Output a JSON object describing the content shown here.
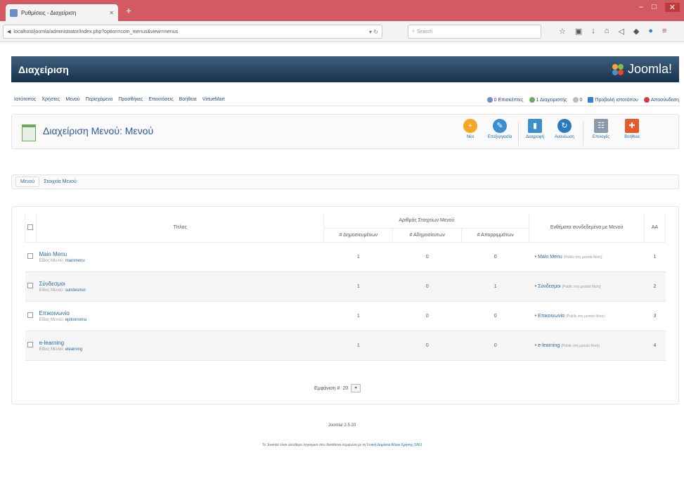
{
  "browser": {
    "tab_title": "Ρυθμίσεις - Διαχείριση",
    "url": "localhost/joomla/administrator/index.php?option=com_menus&view=menus",
    "search_placeholder": "Search"
  },
  "admin": {
    "title": "Διαχείριση",
    "logo_text": "Joomla!"
  },
  "menu": [
    "Ιστότοπος",
    "Χρήστες",
    "Μενού",
    "Περιεχόμενο",
    "Προσθήκες",
    "Επεκτάσεις",
    "Βοήθεια",
    "VirtueMart"
  ],
  "status": {
    "visitors": "0 Επισκέπτες",
    "admins": "1 Διαχειριστής",
    "messages": "0",
    "view_site": "Προβολή ιστοτόπου",
    "logout": "Αποσύνδεση"
  },
  "page_title": "Διαχείριση Μενού: Μενού",
  "toolbar": {
    "new": "Νέο",
    "edit": "Επεξεργασία",
    "delete": "Διαγραφή",
    "rebuild": "Ανανέωση",
    "options": "Επιλογές",
    "help": "Βοήθεια"
  },
  "subtabs": [
    "Μενού",
    "Στοιχεία Μενού"
  ],
  "grid": {
    "h_title": "Τίτλος",
    "h_group": "Αριθμός Στοιχείων Μενού",
    "h_pub": "# Δημοσιευμένων",
    "h_unpub": "# Αδημοσίευτων",
    "h_trash": "# Απορριμμάτων",
    "h_mods": "Ενθέματα συνδεδεμένα με Μενού",
    "h_id": "ΑΑ",
    "rows": [
      {
        "title": "Main Menu",
        "type_label": "Είδος Μενού:",
        "type": "mainmenu",
        "pub": "1",
        "unpub": "0",
        "trash": "0",
        "module": "Main Menu",
        "module_note": "(Public στη μεσαία θέση)",
        "id": "1"
      },
      {
        "title": "Σύνδεσμοι",
        "type_label": "Είδος Μενού:",
        "type": "sundesmoi",
        "pub": "1",
        "unpub": "0",
        "trash": "1",
        "module": "Σύνδεσμοι",
        "module_note": "(Public στη μεσαία θέση)",
        "id": "2"
      },
      {
        "title": "Επικοινωνία",
        "type_label": "Είδος Μενού:",
        "type": "epikoinonia",
        "pub": "1",
        "unpub": "0",
        "trash": "0",
        "module": "Επικοινωνία",
        "module_note": "(Public στη μεσαία θέση)",
        "id": "3"
      },
      {
        "title": "e-learning",
        "type_label": "Είδος Μενού:",
        "type": "elearning",
        "pub": "1",
        "unpub": "0",
        "trash": "0",
        "module": "e-learning",
        "module_note": "(Public στη μεσαία θέση)",
        "id": "4"
      }
    ]
  },
  "pager": {
    "label": "Εμφάνιση #",
    "value": "20"
  },
  "footer": {
    "version": "Joomla! 2.5.20",
    "license_prefix": "Το Joomla! είναι ελεύθερο λογισμικό που διατίθεται σύμφωνα με τη",
    "license_link": "Γενική Δημόσια Άδεια Χρήσης GNU"
  }
}
